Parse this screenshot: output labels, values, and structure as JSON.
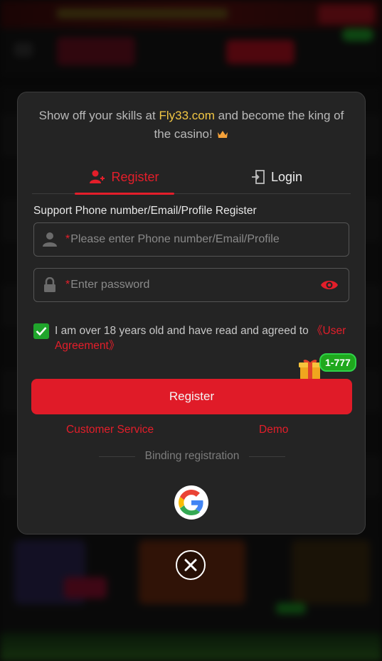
{
  "promo": {
    "text_before": "Show off your skills at ",
    "brand": "Fly33.com",
    "text_after": " and become the king of the casino!",
    "icon": "crown-icon"
  },
  "tabs": [
    {
      "label": "Register",
      "icon": "add-user-icon",
      "active": true
    },
    {
      "label": "Login",
      "icon": "login-icon",
      "active": false
    }
  ],
  "form": {
    "support_label": "Support Phone number/Email/Profile Register",
    "phone": {
      "required_mark": "*",
      "placeholder": "Please enter Phone number/Email/Profile",
      "value": "",
      "icon": "user-icon"
    },
    "password": {
      "required_mark": "*",
      "placeholder": "Enter password",
      "value": "",
      "icon": "lock-icon",
      "toggle_icon": "eye-icon"
    },
    "agreement": {
      "checked": true,
      "text": "I am over 18 years old and have read and agreed to ",
      "link": "《User Agreement》"
    },
    "gift_badge": "1-777",
    "submit_label": "Register"
  },
  "links": {
    "customer_service": "Customer Service",
    "demo": "Demo"
  },
  "binding_label": "Binding registration",
  "colors": {
    "accent": "#e01b28",
    "brand_yellow": "#f2c744",
    "checkbox_green": "#20a52c",
    "modal_bg": "#242424"
  }
}
